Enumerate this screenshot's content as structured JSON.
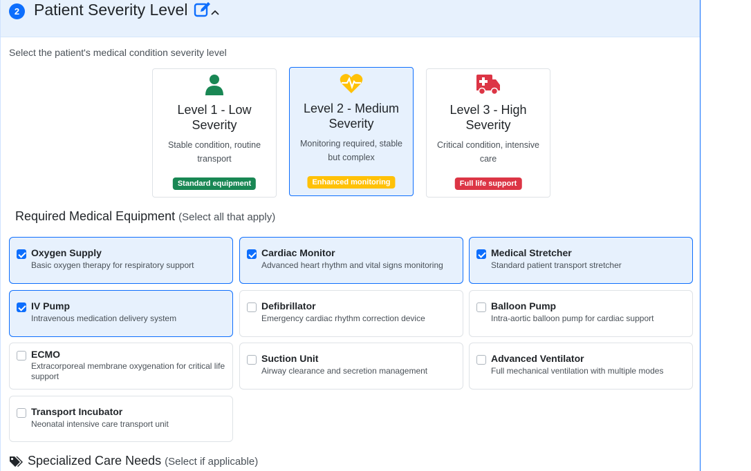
{
  "section": {
    "step": "2",
    "title": "Patient Severity Level",
    "subtitle": "Select the patient's medical condition severity level"
  },
  "levels": [
    {
      "title": "Level 1 - Low Severity",
      "description": "Stable condition, routine transport",
      "badge": "Standard equipment",
      "icon": "user-icon",
      "color": "#198754",
      "selected": false
    },
    {
      "title": "Level 2 - Medium Severity",
      "description": "Monitoring required, stable but complex",
      "badge": "Enhanced monitoring",
      "icon": "heartbeat-icon",
      "color": "#ffc107",
      "selected": true
    },
    {
      "title": "Level 3 - High Severity",
      "description": "Critical condition, intensive care",
      "badge": "Full life support",
      "icon": "ambulance-icon",
      "color": "#dc3545",
      "selected": false
    }
  ],
  "equipment": {
    "title": "Required Medical Equipment",
    "hint": "(Select all that apply)",
    "items": [
      {
        "name": "Oxygen Supply",
        "description": "Basic oxygen therapy for respiratory support",
        "checked": true
      },
      {
        "name": "Cardiac Monitor",
        "description": "Advanced heart rhythm and vital signs monitoring",
        "checked": true
      },
      {
        "name": "Medical Stretcher",
        "description": "Standard patient transport stretcher",
        "checked": true
      },
      {
        "name": "IV Pump",
        "description": "Intravenous medication delivery system",
        "checked": true
      },
      {
        "name": "Defibrillator",
        "description": "Emergency cardiac rhythm correction device",
        "checked": false
      },
      {
        "name": "Balloon Pump",
        "description": "Intra-aortic balloon pump for cardiac support",
        "checked": false
      },
      {
        "name": "ECMO",
        "description": "Extracorporeal membrane oxygenation for critical life support",
        "checked": false
      },
      {
        "name": "Suction Unit",
        "description": "Airway clearance and secretion management",
        "checked": false
      },
      {
        "name": "Advanced Ventilator",
        "description": "Full mechanical ventilation with multiple modes",
        "checked": false
      },
      {
        "name": "Transport Incubator",
        "description": "Neonatal intensive care transport unit",
        "checked": false
      }
    ]
  },
  "specialized": {
    "title": "Specialized Care Needs",
    "hint": "(Select if applicable)",
    "icon": "tags-icon"
  },
  "colors": {
    "accent": "#0d6efd",
    "selected_bg": "#e7f1fd"
  }
}
